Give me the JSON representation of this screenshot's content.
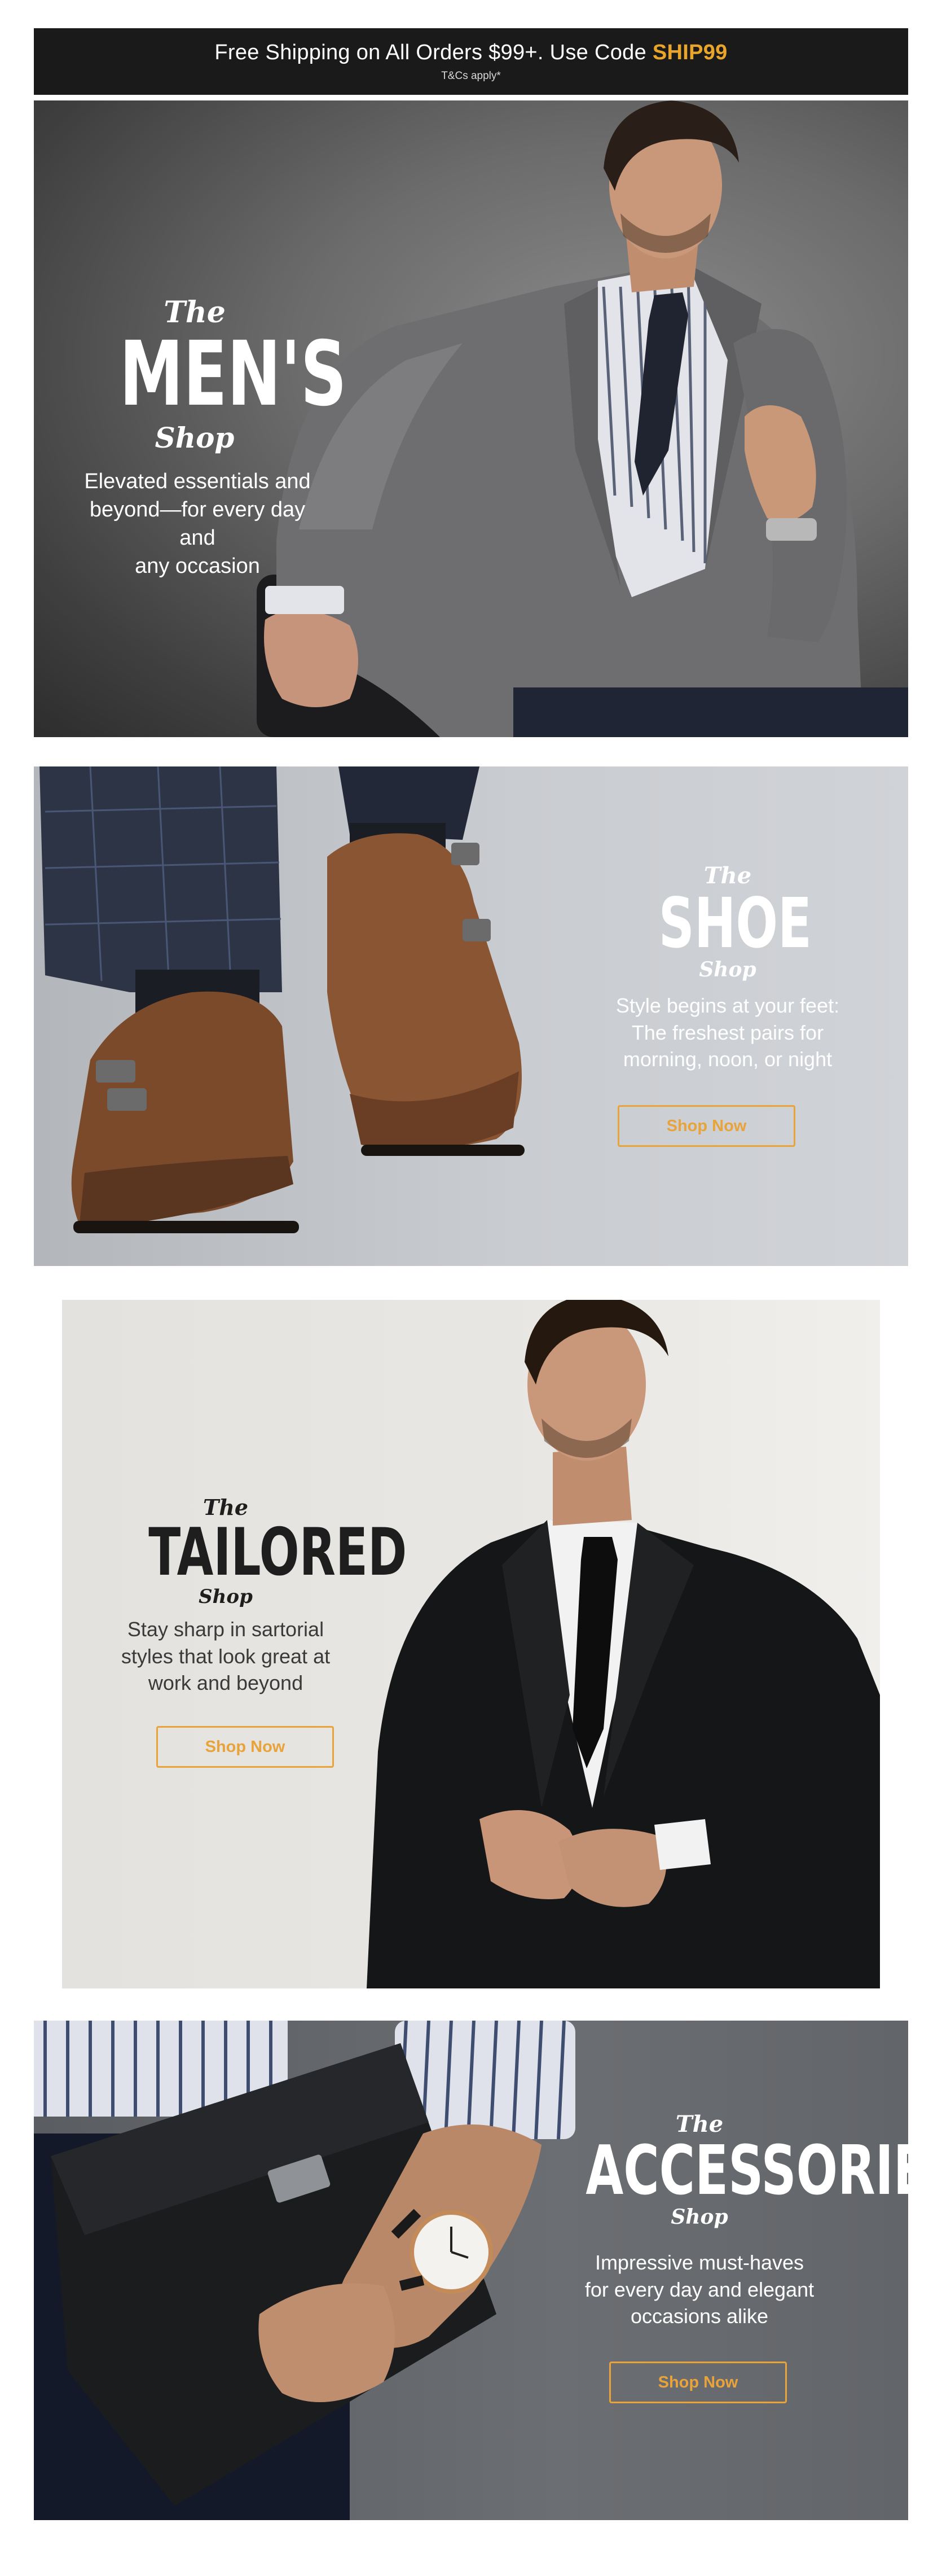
{
  "promo": {
    "main_text": "Free Shipping on All Orders $99+. Use Code ",
    "code": "SHIP99",
    "terms": "T&Cs apply*"
  },
  "banners": [
    {
      "the": "The",
      "title": "MEN'S",
      "shop": "Shop",
      "description_lines": [
        "Elevated essentials and",
        "beyond—for every day and",
        "any occasion"
      ]
    },
    {
      "the": "The",
      "title": "SHOE",
      "shop": "Shop",
      "description_lines": [
        "Style begins at your feet:",
        "The freshest pairs for",
        "morning, noon, or night"
      ],
      "button": "Shop Now"
    },
    {
      "the": "The",
      "title": "TAILORED",
      "shop": "Shop",
      "description_lines": [
        "Stay sharp in sartorial",
        "styles that look great at",
        "work and beyond"
      ],
      "button": "Shop Now"
    },
    {
      "the": "The",
      "title": "ACCESSORIES",
      "shop": "Shop",
      "description_lines": [
        "Impressive must-haves",
        "for every day and elegant",
        "occasions alike"
      ],
      "button": "Shop Now"
    }
  ],
  "colors": {
    "promo_background": "#1a1a1a",
    "accent": "#e9a52a",
    "button_border": "#e8a33a",
    "text_light": "#ffffff",
    "text_dark": "#3a3a3a"
  },
  "icons": [
    "mens-model-photo",
    "shoes-photo",
    "tailored-model-photo",
    "accessories-photo"
  ]
}
